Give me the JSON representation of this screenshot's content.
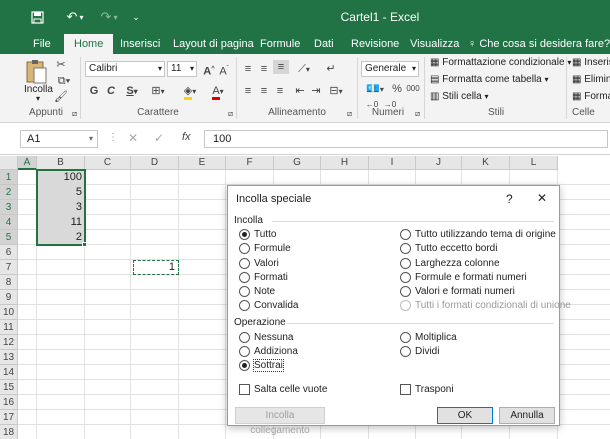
{
  "window": {
    "title": "Cartel1 - Excel"
  },
  "tabs": [
    {
      "label": "File"
    },
    {
      "label": "Home"
    },
    {
      "label": "Inserisci"
    },
    {
      "label": "Layout di pagina"
    },
    {
      "label": "Formule"
    },
    {
      "label": "Dati"
    },
    {
      "label": "Revisione"
    },
    {
      "label": "Visualizza"
    },
    {
      "label": "Che cosa si desidera fare?"
    }
  ],
  "ribbon": {
    "paste_label": "Incolla",
    "groups": {
      "clipboard": "Appunti",
      "font": "Carattere",
      "alignment": "Allineamento",
      "number": "Numeri",
      "styles": "Stili",
      "cells": "Celle"
    },
    "font_name": "Calibri",
    "font_size": "11",
    "bold": "G",
    "italic": "C",
    "underline": "S",
    "number_format": "Generale",
    "percent": "%",
    "thousands": "000",
    "styles": {
      "conditional": "Formattazione condizionale",
      "table": "Formatta come tabella",
      "cell": "Stili cella"
    },
    "cells": {
      "insert": "Inseris",
      "delete": "Elimin",
      "format": "Forma"
    }
  },
  "formula_bar": {
    "cell_ref": "A1",
    "fx": "fx",
    "value": "100"
  },
  "grid": {
    "columns": [
      "A",
      "B",
      "C",
      "D",
      "E",
      "F",
      "G",
      "H",
      "I",
      "J",
      "K",
      "L"
    ],
    "rows": [
      "1",
      "2",
      "3",
      "4",
      "5",
      "6",
      "7",
      "8",
      "9",
      "10",
      "11",
      "12",
      "13",
      "14",
      "15",
      "16",
      "17",
      "18"
    ],
    "cells": {
      "A1": "100",
      "A2": "5",
      "A3": "3",
      "A4": "11",
      "A5": "2",
      "C7": "1"
    }
  },
  "dialog": {
    "title": "Incolla speciale",
    "help": "?",
    "close": "✕",
    "paste_section": "Incolla",
    "paste_left": [
      "Tutto",
      "Formule",
      "Valori",
      "Formati",
      "Note",
      "Convalida"
    ],
    "paste_right": [
      "Tutto utilizzando tema di origine",
      "Tutto eccetto bordi",
      "Larghezza colonne",
      "Formule e formati numeri",
      "Valori e formati numeri",
      "Tutti i formati condizionali di unione"
    ],
    "operation_section": "Operazione",
    "op_left": [
      "Nessuna",
      "Addiziona",
      "Sottrai"
    ],
    "op_right": [
      "Moltiplica",
      "Dividi"
    ],
    "skip_blanks": "Salta celle vuote",
    "transpose": "Trasponi",
    "paste_link_button": "Incolla collegamento",
    "ok_button": "OK",
    "cancel_button": "Annulla"
  },
  "colors": {
    "excel_green": "#217346",
    "selection_fill": "#d9d9d9"
  }
}
